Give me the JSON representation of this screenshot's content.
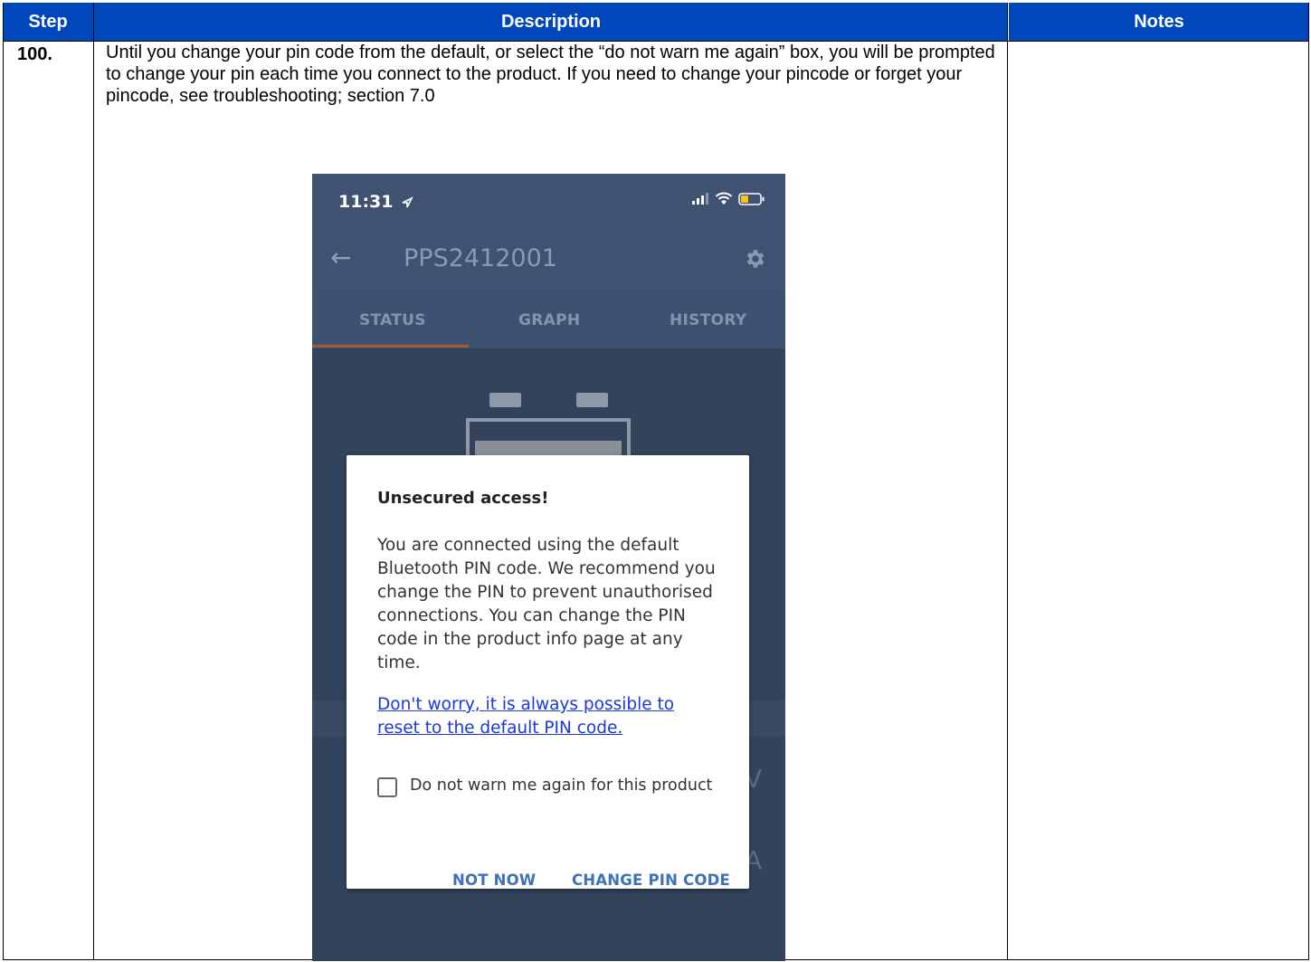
{
  "table": {
    "headers": {
      "step": "Step",
      "description": "Description",
      "notes": "Notes"
    },
    "row": {
      "step": "100.",
      "description": "Until you change your pin code from the default, or select the “do not warn me again” box, you will be prompted to change your pin each time you connect to the product.  If you need to change your pincode or forget your pincode, see troubleshooting; section 7.0",
      "notes": ""
    }
  },
  "phone": {
    "status_bar": {
      "time": "11:31"
    },
    "app_bar": {
      "title": "PPS2412001"
    },
    "tabs": [
      {
        "label": "STATUS",
        "active": true
      },
      {
        "label": "GRAPH",
        "active": false
      },
      {
        "label": "HISTORY",
        "active": false
      }
    ],
    "background_units": {
      "voltage": "V",
      "current": "A"
    },
    "dialog": {
      "title": "Unsecured access!",
      "body": "You are connected using the default Bluetooth PIN code. We recommend you change the PIN to prevent unauthorised connections. You can change the PIN code in the product info page at any time.",
      "link": "Don't worry, it is always possible to reset to the default PIN code.",
      "checkbox_label": "Do not warn me again for this product",
      "checkbox_checked": false,
      "buttons": {
        "not_now": "NOT NOW",
        "change_pin": "CHANGE PIN CODE"
      }
    }
  },
  "colors": {
    "header_bg": "#0047bb",
    "app_bg": "#3f5271",
    "tab_indicator": "#a05a38",
    "link": "#1a37e0",
    "dialog_button": "#3d72b9"
  }
}
